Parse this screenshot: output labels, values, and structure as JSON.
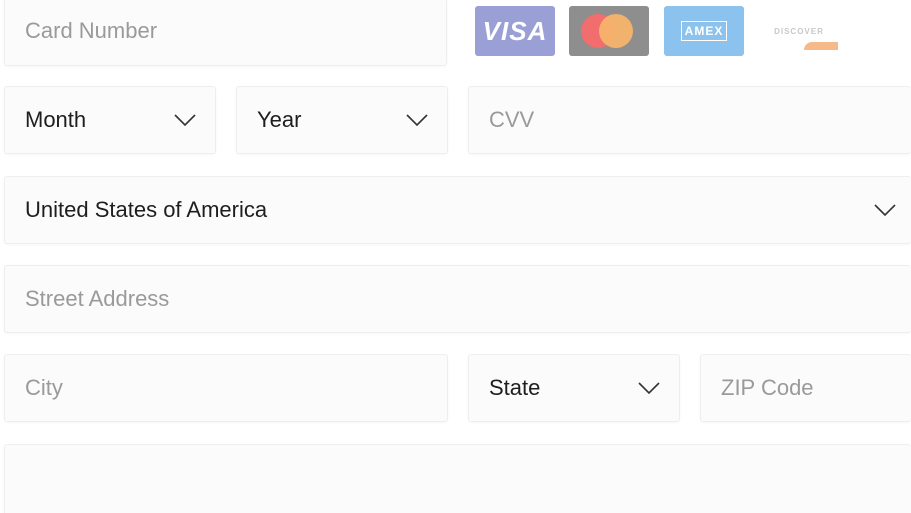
{
  "card": {
    "number_placeholder": "Card Number",
    "logos": [
      "VISA",
      "mastercard",
      "AMEX",
      "DISCOVER"
    ],
    "visa_label": "VISA",
    "amex_label": "AMEX",
    "discover_label": "DISCOVER"
  },
  "expiry": {
    "month_value": "Month",
    "year_value": "Year"
  },
  "cvv": {
    "placeholder": "CVV"
  },
  "country": {
    "value": "United States of America"
  },
  "address": {
    "street_placeholder": "Street Address",
    "city_placeholder": "City",
    "state_value": "State",
    "zip_placeholder": "ZIP Code"
  },
  "icons": {
    "dropdown": "chevron-down-icon"
  },
  "colors": {
    "field_bg": "#fbfbfb",
    "field_border": "#eeeeee",
    "placeholder_text": "#9a9a9a",
    "value_text": "#1e1e1e"
  }
}
